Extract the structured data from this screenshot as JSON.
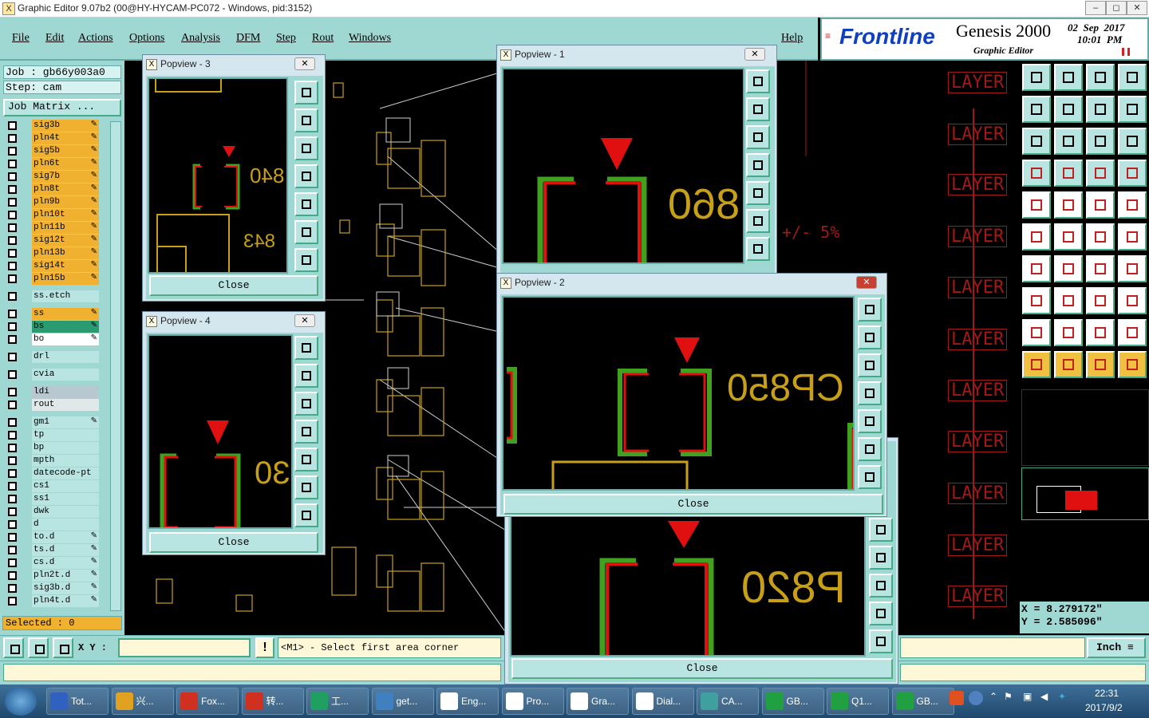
{
  "window": {
    "title": "Graphic Editor 9.07b2 (00@HY-HYCAM-PC072 - Windows, pid:3152)",
    "min": "–",
    "max": "◻",
    "close": "✕"
  },
  "menu": [
    "File",
    "Edit",
    "Actions",
    "Options",
    "Analysis",
    "DFM",
    "Step",
    "Rout",
    "Windows"
  ],
  "help": "Help",
  "brand": {
    "logo": "Frontline",
    "product": "Genesis 2000",
    "subtitle": "Graphic Editor",
    "date": "02  Sep  2017",
    "time": "10:01  PM"
  },
  "job": {
    "job_line": "Job : gb66y003a0",
    "step_line": "Step: cam",
    "matrix_label": "Job Matrix ..."
  },
  "layers": [
    {
      "name": "sig3b",
      "color": "#f0b030",
      "edit": "✎"
    },
    {
      "name": "pln4t",
      "color": "#f0b030",
      "edit": "✎"
    },
    {
      "name": "sig5b",
      "color": "#f0b030",
      "edit": "✎"
    },
    {
      "name": "pln6t",
      "color": "#f0b030",
      "edit": "✎"
    },
    {
      "name": "sig7b",
      "color": "#f0b030",
      "edit": "✎"
    },
    {
      "name": "pln8t",
      "color": "#f0b030",
      "edit": "✎"
    },
    {
      "name": "pln9b",
      "color": "#f0b030",
      "edit": "✎"
    },
    {
      "name": "pln10t",
      "color": "#f0b030",
      "edit": "✎"
    },
    {
      "name": "pln11b",
      "color": "#f0b030",
      "edit": "✎"
    },
    {
      "name": "sig12t",
      "color": "#f0b030",
      "edit": "✎"
    },
    {
      "name": "pln13b",
      "color": "#f0b030",
      "edit": "✎"
    },
    {
      "name": "sig14t",
      "color": "#f0b030",
      "edit": "✎"
    },
    {
      "name": "pln15b",
      "color": "#f0b030",
      "edit": "✎"
    },
    {
      "name": "ss.etch",
      "color": "#b8e4e1",
      "edit": ""
    },
    {
      "name": "ss",
      "color": "#f0b030",
      "edit": "✎"
    },
    {
      "name": "bs",
      "color": "#2a9a70",
      "edit": "✎"
    },
    {
      "name": "bo",
      "color": "#ffffff",
      "edit": "✎"
    },
    {
      "name": "drl",
      "color": "#b8e4e1",
      "edit": ""
    },
    {
      "name": "cvia",
      "color": "#b8e4e1",
      "edit": ""
    },
    {
      "name": "ldi",
      "color": "#b8c8d0",
      "edit": ""
    },
    {
      "name": "rout",
      "color": "#e0e8ea",
      "edit": ""
    },
    {
      "name": "gm1",
      "color": "#b8e4e1",
      "edit": "✎"
    },
    {
      "name": "tp",
      "color": "#b8e4e1",
      "edit": ""
    },
    {
      "name": "bp",
      "color": "#b8e4e1",
      "edit": ""
    },
    {
      "name": "mpth",
      "color": "#b8e4e1",
      "edit": ""
    },
    {
      "name": "datecode-pt",
      "color": "#b8e4e1",
      "edit": ""
    },
    {
      "name": "cs1",
      "color": "#b8e4e1",
      "edit": ""
    },
    {
      "name": "ss1",
      "color": "#b8e4e1",
      "edit": ""
    },
    {
      "name": "dwk",
      "color": "#b8e4e1",
      "edit": ""
    },
    {
      "name": "d",
      "color": "#b8e4e1",
      "edit": ""
    },
    {
      "name": "to.d",
      "color": "#b8e4e1",
      "edit": "✎"
    },
    {
      "name": "ts.d",
      "color": "#b8e4e1",
      "edit": "✎"
    },
    {
      "name": "cs.d",
      "color": "#b8e4e1",
      "edit": "✎"
    },
    {
      "name": "pln2t.d",
      "color": "#b8e4e1",
      "edit": "✎"
    },
    {
      "name": "sig3b.d",
      "color": "#b8e4e1",
      "edit": "✎"
    },
    {
      "name": "pln4t.d",
      "color": "#b8e4e1",
      "edit": "✎"
    }
  ],
  "selected": "Selected : 0",
  "command": {
    "xy_label": "X Y :",
    "xy_value": "",
    "prompt": "<M1> - Select first area corner",
    "units": "Inch"
  },
  "coords": {
    "x": "X = 8.279172\"",
    "y": "Y = 2.585096\""
  },
  "canvas_text": {
    "tolerance": "+/- 5%",
    "layer_word": "LAYER"
  },
  "popviews": [
    {
      "title": "Popview - 3",
      "close": "Close",
      "label": "840",
      "label2": "843"
    },
    {
      "title": "Popview - 1",
      "close": "Close",
      "label": "860"
    },
    {
      "title": "Popview - 2",
      "close": "Close",
      "label": "CP850"
    },
    {
      "title": "Popview - 4",
      "close": "Close",
      "label": "30"
    },
    {
      "title": "",
      "close": "Close",
      "label": "P820"
    }
  ],
  "taskbar": {
    "items": [
      "Tot...",
      "兴...",
      "Fox...",
      "转...",
      "工...",
      "get...",
      "Eng...",
      "Pro...",
      "Gra...",
      "Dial...",
      "CA...",
      "GB...",
      "Q1...",
      "GB..."
    ],
    "time": "22:31",
    "date": "2017/9/2"
  },
  "colors": {
    "panel": "#9fd7d3",
    "pad_red": "#e01010",
    "pad_green": "#40a020",
    "text_gold": "#c8a018"
  }
}
